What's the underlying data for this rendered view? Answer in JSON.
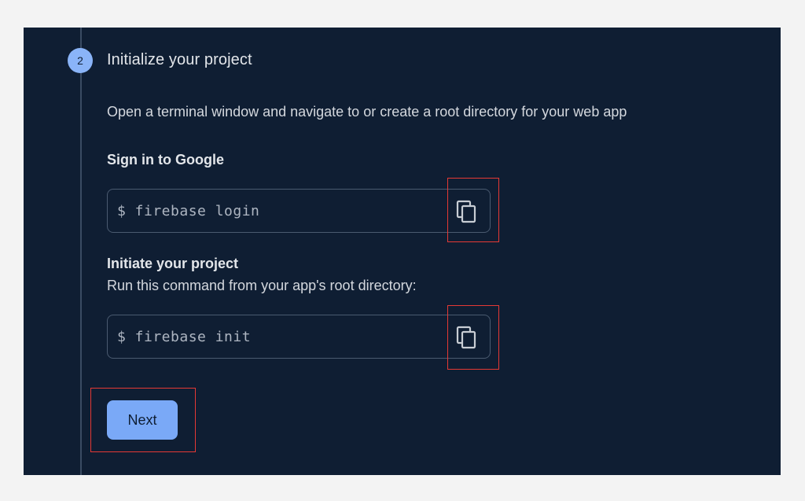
{
  "step": {
    "number": "2",
    "title": "Initialize your project",
    "description": "Open a terminal window and navigate to or create a root directory for your web app"
  },
  "sign_in": {
    "label": "Sign in to Google",
    "command": "$ firebase login",
    "copy_icon": "copy-icon"
  },
  "init": {
    "label": "Initiate your project",
    "hint": "Run this command from your app's root directory:",
    "command": "$ firebase init",
    "copy_icon": "copy-icon"
  },
  "actions": {
    "next_label": "Next"
  },
  "colors": {
    "panel_bg": "#0f1e33",
    "accent": "#8ab4f8",
    "button_bg": "#7aa9f7",
    "highlight": "#e53935"
  }
}
